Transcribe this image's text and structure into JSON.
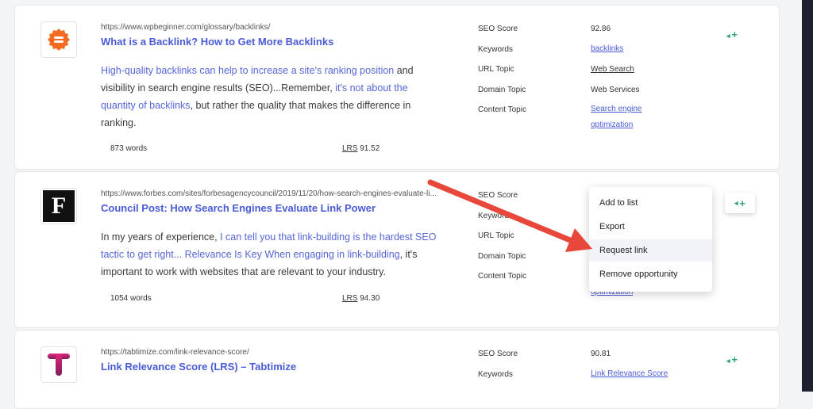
{
  "results": [
    {
      "url": "https://www.wpbeginner.com/glossary/backlinks/",
      "title": "What is a Backlink? How to Get More Backlinks",
      "snippet": {
        "p1": "High-quality backlinks can help to increase a site's ranking position",
        "p2": " and visibility in search engine results (SEO)...Remember, ",
        "p3": "it's not about the quantity of backlinks",
        "p4": ", but rather the quality that makes the difference in ranking."
      },
      "words": "873 words",
      "lrs_label": "LRS",
      "lrs_value": "91.52",
      "metrics": {
        "seo_label": "SEO Score",
        "seo_value": "92.86",
        "kw_label": "Keywords",
        "kw_value": "backlinks",
        "url_topic_label": "URL Topic",
        "url_topic_value": "Web Search",
        "domain_topic_label": "Domain Topic",
        "domain_topic_value": "Web Services",
        "content_topic_label": "Content Topic",
        "content_topic_value_1": "Search engine",
        "content_topic_value_2": "optimization"
      },
      "add_icon": "+"
    },
    {
      "url": "https://www.forbes.com/sites/forbesagencycouncil/2019/11/20/how-search-engines-evaluate-li...",
      "title": "Council Post: How Search Engines Evaluate Link Power",
      "logo_letter": "F",
      "snippet": {
        "p1": "In my years of experience, ",
        "p2": "I can tell you that link-building is the hardest SEO tactic to get right... Relevance Is Key When engaging in link-building",
        "p3": ", it's important to work with websites that are relevant to your industry."
      },
      "words": "1054 words",
      "lrs_label": "LRS",
      "lrs_value": "94.30",
      "metrics": {
        "seo_label": "SEO Score",
        "kw_label": "Keywords",
        "url_topic_label": "URL Topic",
        "domain_topic_label": "Domain Topic",
        "content_topic_label": "Content Topic",
        "content_topic_value_2": "optimization"
      },
      "add_icon": "+"
    },
    {
      "url": "https://tabtimize.com/link-relevance-score/",
      "title": "Link Relevance Score (LRS) – Tabtimize",
      "logo_letter": "T",
      "metrics": {
        "seo_label": "SEO Score",
        "seo_value": "90.81",
        "kw_label": "Keywords",
        "kw_value": "Link Relevance Score"
      },
      "add_icon": "+"
    }
  ],
  "context_menu": {
    "items": [
      "Add to list",
      "Export",
      "Request link",
      "Remove opportunity"
    ]
  },
  "icons": {
    "chevron": "chevron-left-icon",
    "add": "plus-icon",
    "annotation": "red-arrow"
  },
  "colors": {
    "accent": "#4a5bd6",
    "add_green": "#2aa56f",
    "arrow_red": "#e8473c",
    "wpbeginner_orange": "#f26b21"
  }
}
